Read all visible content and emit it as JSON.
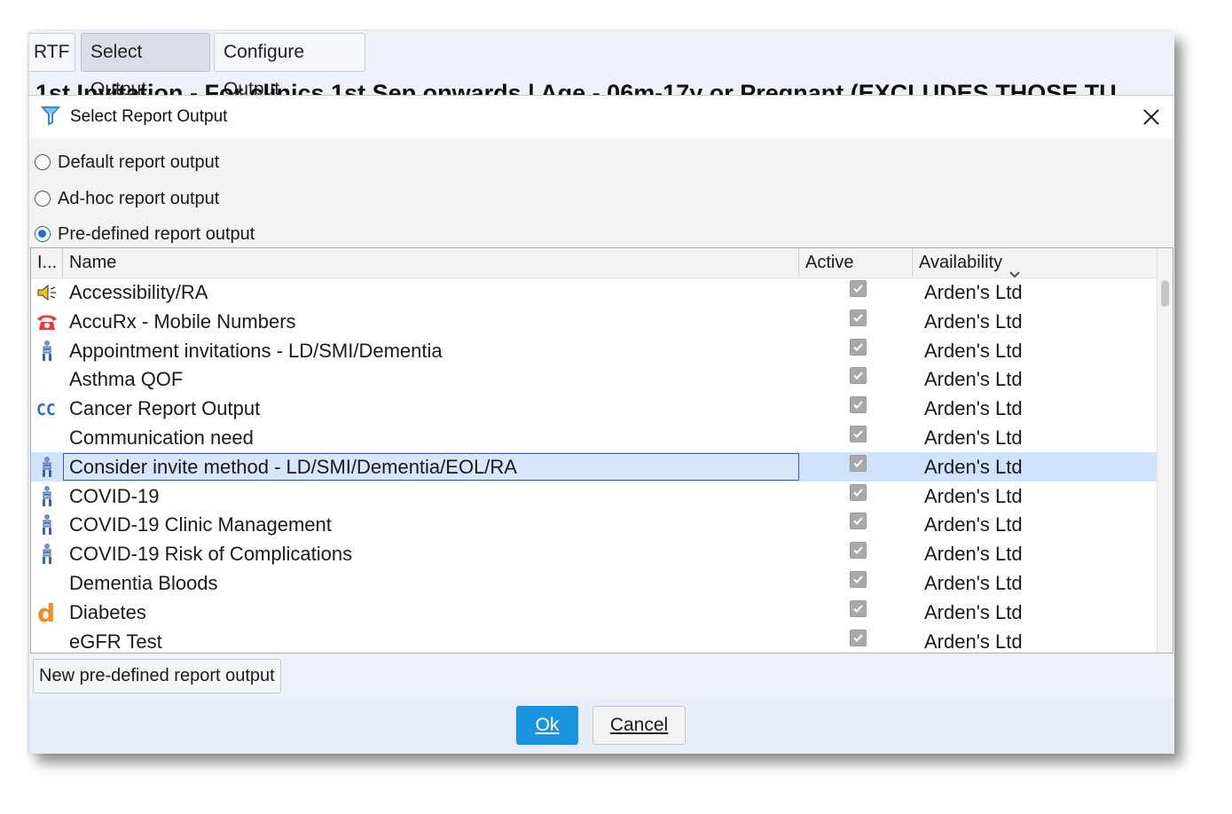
{
  "background": {
    "tabs": [
      "RTF",
      "Select Output",
      "Configure Output"
    ],
    "heading": "1st Invitation - For clinics 1st Sep onwards | Age - 06m-17y or Pregnant (EXCLUDES THOSE TU"
  },
  "dialog": {
    "title": "Select Report Output",
    "title_icon": "filter-funnel-icon",
    "close_icon": "close-icon",
    "radios": [
      {
        "label": "Default report output",
        "checked": false
      },
      {
        "label": "Ad-hoc report output",
        "checked": false
      },
      {
        "label": "Pre-defined report output",
        "checked": true
      }
    ],
    "grid": {
      "columns": {
        "icon": "I...",
        "name": "Name",
        "active": "Active",
        "availability": "Availability"
      },
      "sort_icon": "chevron-down-icon",
      "rows": [
        {
          "icon": "speaker-icon",
          "name": "Accessibility/RA",
          "active": true,
          "availability": "Arden's Ltd",
          "selected": false
        },
        {
          "icon": "phone-icon",
          "name": "AccuRx - Mobile Numbers",
          "active": true,
          "availability": "Arden's Ltd",
          "selected": false
        },
        {
          "icon": "person-group-icon",
          "name": "Appointment invitations - LD/SMI/Dementia",
          "active": true,
          "availability": "Arden's Ltd",
          "selected": false
        },
        {
          "icon": "",
          "name": "Asthma QOF",
          "active": true,
          "availability": "Arden's Ltd",
          "selected": false
        },
        {
          "icon": "cc-icon",
          "name": "Cancer Report Output",
          "active": true,
          "availability": "Arden's Ltd",
          "selected": false
        },
        {
          "icon": "",
          "name": "Communication need",
          "active": true,
          "availability": "Arden's Ltd",
          "selected": false
        },
        {
          "icon": "person-group-icon",
          "name": "Consider invite method - LD/SMI/Dementia/EOL/RA",
          "active": true,
          "availability": "Arden's Ltd",
          "selected": true
        },
        {
          "icon": "person-group-icon",
          "name": "COVID-19",
          "active": true,
          "availability": "Arden's Ltd",
          "selected": false
        },
        {
          "icon": "person-group-icon",
          "name": "COVID-19 Clinic Management",
          "active": true,
          "availability": "Arden's Ltd",
          "selected": false
        },
        {
          "icon": "person-group-icon",
          "name": "COVID-19 Risk of Complications",
          "active": true,
          "availability": "Arden's Ltd",
          "selected": false
        },
        {
          "icon": "",
          "name": "Dementia Bloods",
          "active": true,
          "availability": "Arden's Ltd",
          "selected": false
        },
        {
          "icon": "diabetes-d-icon",
          "name": "Diabetes",
          "active": true,
          "availability": "Arden's Ltd",
          "selected": false
        },
        {
          "icon": "",
          "name": "eGFR Test",
          "active": true,
          "availability": "Arden's Ltd",
          "selected": false
        }
      ]
    },
    "new_button": "New pre-defined report output",
    "ok_button": "Ok",
    "cancel_button": "Cancel",
    "colors": {
      "accent": "#1a93e0",
      "selection": "#cfe2fb",
      "selection_border": "#3a5fa8"
    }
  }
}
